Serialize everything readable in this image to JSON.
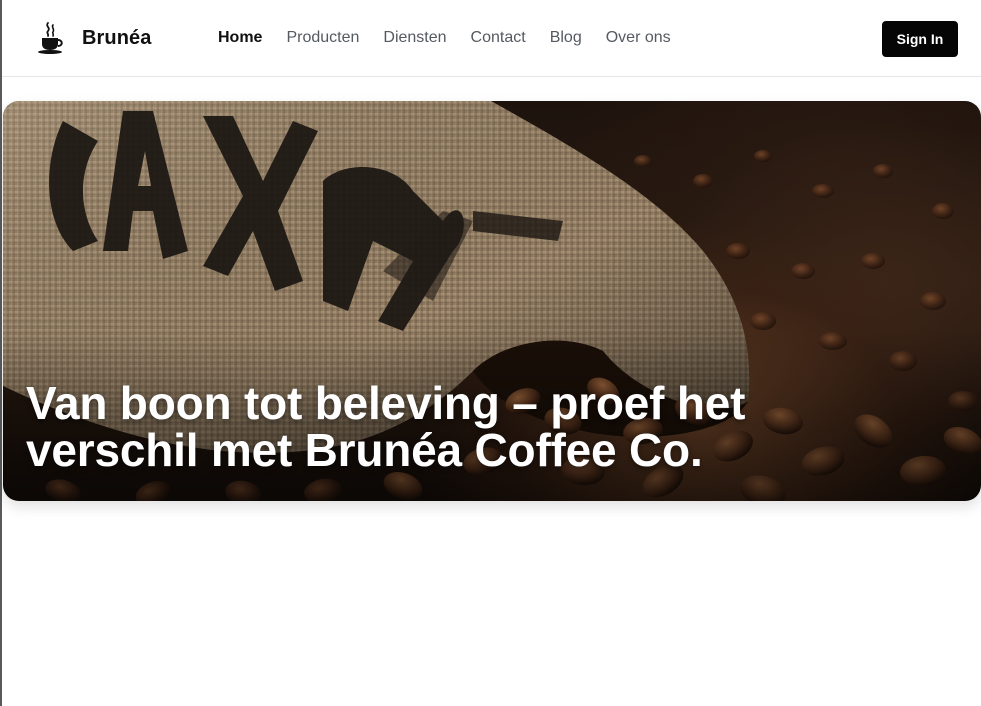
{
  "brand": {
    "name": "Brunéa",
    "icon": "coffee-cup-icon"
  },
  "nav": {
    "items": [
      {
        "label": "Home",
        "active": true
      },
      {
        "label": "Producten",
        "active": false
      },
      {
        "label": "Diensten",
        "active": false
      },
      {
        "label": "Contact",
        "active": false
      },
      {
        "label": "Blog",
        "active": false
      },
      {
        "label": "Over ons",
        "active": false
      }
    ]
  },
  "header": {
    "signin_label": "Sign In"
  },
  "hero": {
    "title": "Van boon tot beleving – proef het verschil met Brunéa Coffee Co.",
    "image": "coffee-sack-beans-image"
  },
  "colors": {
    "accent": "#050505",
    "nav_text": "#555a60",
    "active_text": "#111111",
    "hero_title": "#ffffff"
  }
}
